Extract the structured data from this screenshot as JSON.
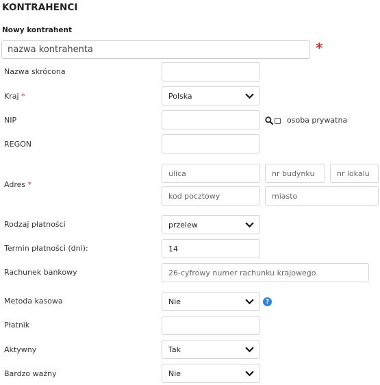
{
  "header": {
    "title": "KONTRAHENCI",
    "subtitle": "Nowy kontrahent"
  },
  "name_field": {
    "placeholder": "nazwa kontrahenta",
    "required_mark": "*"
  },
  "required_mark": "*",
  "fields": {
    "short_name": {
      "label": "Nazwa skrócona",
      "value": ""
    },
    "country": {
      "label": "Kraj",
      "selected": "Polska"
    },
    "nip": {
      "label": "NIP",
      "value": "",
      "private_label": "osoba prywatna",
      "private_checked": false
    },
    "regon": {
      "label": "REGON",
      "value": ""
    },
    "address": {
      "label": "Adres",
      "street": "ulica",
      "building": "nr budynku",
      "unit": "nr lokalu",
      "postal": "kod pocztowy",
      "city": "miasto"
    },
    "payment_type": {
      "label": "Rodzaj płatności",
      "selected": "przelew"
    },
    "payment_term": {
      "label": "Termin płatności (dni):",
      "value": "14"
    },
    "bank_account": {
      "label": "Rachunek bankowy",
      "placeholder": "26-cyfrowy numer rachunku krajowego"
    },
    "cash_method": {
      "label": "Metoda kasowa",
      "selected": "Nie",
      "help": "?"
    },
    "payer": {
      "label": "Płatnik",
      "value": ""
    },
    "active": {
      "label": "Aktywny",
      "selected": "Tak"
    },
    "very_important": {
      "label": "Bardzo ważny",
      "selected": "Nie"
    }
  },
  "icons": {
    "search": "search-icon",
    "help": "help-icon",
    "chevron": "chevron-down-icon"
  },
  "colors": {
    "required": "#c0392b",
    "help": "#2f86d8",
    "border": "#d4d4d4"
  }
}
